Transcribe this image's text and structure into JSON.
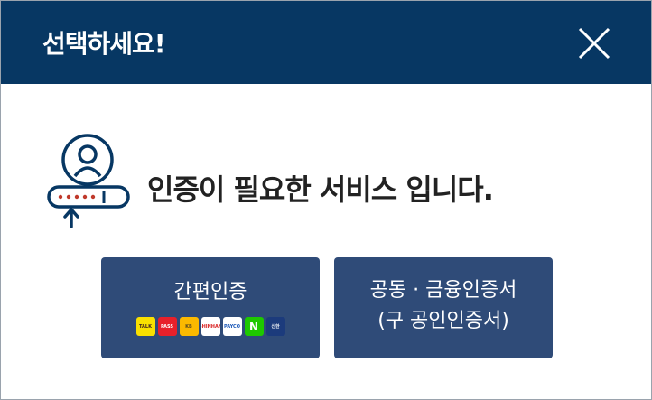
{
  "header": {
    "title": "선택하세요!"
  },
  "main": {
    "message": "인증이 필요한 서비스 입니다."
  },
  "buttons": {
    "simple": {
      "label": "간편인증"
    },
    "certificate": {
      "line1": "공동 · 금융인증서",
      "line2": "(구 공인인증서)"
    }
  },
  "providers": [
    {
      "text": "TALK",
      "icon": "kakao-talk-icon",
      "bg": "#f9e000",
      "fg": "#3c1e1e"
    },
    {
      "text": "PASS",
      "icon": "pass-icon",
      "bg": "#e8202a",
      "fg": "#ffffff"
    },
    {
      "text": "KB",
      "icon": "kb-icon",
      "bg": "#fbb900",
      "fg": "#5a4a1f"
    },
    {
      "text": "SHINHAN",
      "icon": "shinhan-icon",
      "bg": "#ffffff",
      "fg": "#d92323"
    },
    {
      "text": "PAYCO",
      "icon": "payco-icon",
      "bg": "#ffffff",
      "fg": "#1b58b8"
    },
    {
      "text": "N",
      "icon": "naver-icon",
      "bg": "#1ec800",
      "fg": "#ffffff"
    },
    {
      "text": "신한",
      "icon": "bank-icon",
      "bg": "#1c3b7c",
      "fg": "#ffffff"
    }
  ],
  "colors": {
    "header_bg": "#073763",
    "button_bg": "#2f4b78",
    "accent": "#c0392b"
  }
}
